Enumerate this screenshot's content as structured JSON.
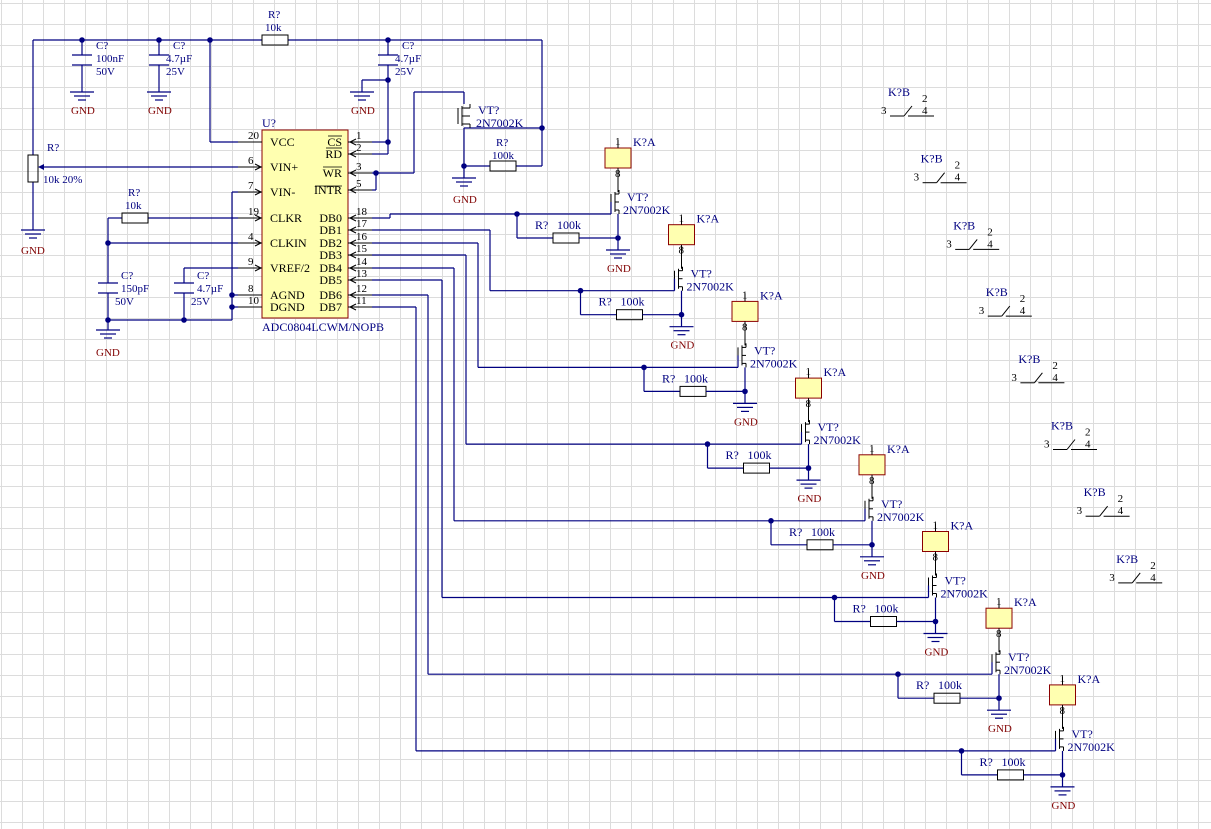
{
  "ic": {
    "designator": "U?",
    "part": "ADC0804LCWM/NOPB",
    "left_pins": [
      {
        "num": "20",
        "name": "VCC"
      },
      {
        "num": "6",
        "name": "VIN+"
      },
      {
        "num": "7",
        "name": "VIN-"
      },
      {
        "num": "19",
        "name": "CLKR"
      },
      {
        "num": "4",
        "name": "CLKIN"
      },
      {
        "num": "9",
        "name": "VREF/2"
      },
      {
        "num": "8",
        "name": "AGND"
      },
      {
        "num": "10",
        "name": "DGND"
      }
    ],
    "right_pins": [
      {
        "num": "1",
        "name": "CS"
      },
      {
        "num": "2",
        "name": "RD"
      },
      {
        "num": "3",
        "name": "WR"
      },
      {
        "num": "5",
        "name": "INTR"
      },
      {
        "num": "18",
        "name": "DB0"
      },
      {
        "num": "17",
        "name": "DB1"
      },
      {
        "num": "16",
        "name": "DB2"
      },
      {
        "num": "15",
        "name": "DB3"
      },
      {
        "num": "14",
        "name": "DB4"
      },
      {
        "num": "13",
        "name": "DB5"
      },
      {
        "num": "12",
        "name": "DB6"
      },
      {
        "num": "11",
        "name": "DB7"
      }
    ]
  },
  "components": {
    "c1": {
      "des": "C?",
      "val": "100nF",
      "rating": "50V"
    },
    "c2": {
      "des": "C?",
      "val": "4.7µF",
      "rating": "25V"
    },
    "c3": {
      "des": "C?",
      "val": "4.7µF",
      "rating": "25V"
    },
    "c4": {
      "des": "C?",
      "val": "150pF",
      "rating": "50V"
    },
    "c5": {
      "des": "C?",
      "val": "4.7µF",
      "rating": "25V"
    },
    "r_top": {
      "des": "R?",
      "val": "10k"
    },
    "r_clk": {
      "des": "R?",
      "val": "10k"
    },
    "pot": {
      "des": "R?",
      "val": "10k 20%"
    },
    "vt_top": {
      "des": "VT?",
      "part": "2N7002K"
    },
    "r_vt_top": {
      "des": "R?",
      "val": "100k"
    }
  },
  "gnd_label": "GND",
  "channels": [
    {
      "relay_a": "K?A",
      "pin1": "1",
      "pin8": "8",
      "vt": "VT?",
      "vt_part": "2N7002K",
      "r": "R?",
      "r_val": "100k",
      "relay_b": "K?B",
      "b_pin2": "2",
      "b_pin3": "3",
      "b_pin4": "4"
    },
    {
      "relay_a": "K?A",
      "pin1": "1",
      "pin8": "8",
      "vt": "VT?",
      "vt_part": "2N7002K",
      "r": "R?",
      "r_val": "100k",
      "relay_b": "K?B",
      "b_pin2": "2",
      "b_pin3": "3",
      "b_pin4": "4"
    },
    {
      "relay_a": "K?A",
      "pin1": "1",
      "pin8": "8",
      "vt": "VT?",
      "vt_part": "2N7002K",
      "r": "R?",
      "r_val": "100k",
      "relay_b": "K?B",
      "b_pin2": "2",
      "b_pin3": "3",
      "b_pin4": "4"
    },
    {
      "relay_a": "K?A",
      "pin1": "1",
      "pin8": "8",
      "vt": "VT?",
      "vt_part": "2N7002K",
      "r": "R?",
      "r_val": "100k",
      "relay_b": "K?B",
      "b_pin2": "2",
      "b_pin3": "3",
      "b_pin4": "4"
    },
    {
      "relay_a": "K?A",
      "pin1": "1",
      "pin8": "8",
      "vt": "VT?",
      "vt_part": "2N7002K",
      "r": "R?",
      "r_val": "100k",
      "relay_b": "K?B",
      "b_pin2": "2",
      "b_pin3": "3",
      "b_pin4": "4"
    },
    {
      "relay_a": "K?A",
      "pin1": "1",
      "pin8": "8",
      "vt": "VT?",
      "vt_part": "2N7002K",
      "r": "R?",
      "r_val": "100k",
      "relay_b": "K?B",
      "b_pin2": "2",
      "b_pin3": "3",
      "b_pin4": "4"
    },
    {
      "relay_a": "K?A",
      "pin1": "1",
      "pin8": "8",
      "vt": "VT?",
      "vt_part": "2N7002K",
      "r": "R?",
      "r_val": "100k",
      "relay_b": "K?B",
      "b_pin2": "2",
      "b_pin3": "3",
      "b_pin4": "4"
    },
    {
      "relay_a": "K?A",
      "pin1": "1",
      "pin8": "8",
      "vt": "VT?",
      "vt_part": "2N7002K",
      "r": "R?",
      "r_val": "100k",
      "relay_b": "K?B",
      "b_pin2": "2",
      "b_pin3": "3",
      "b_pin4": "4"
    }
  ],
  "colors": {
    "wire": "#000080",
    "ic_fill": "#ffffb0",
    "ic_border": "#8b0000",
    "gnd_text": "#800000",
    "grid": "#dcdcdc"
  }
}
